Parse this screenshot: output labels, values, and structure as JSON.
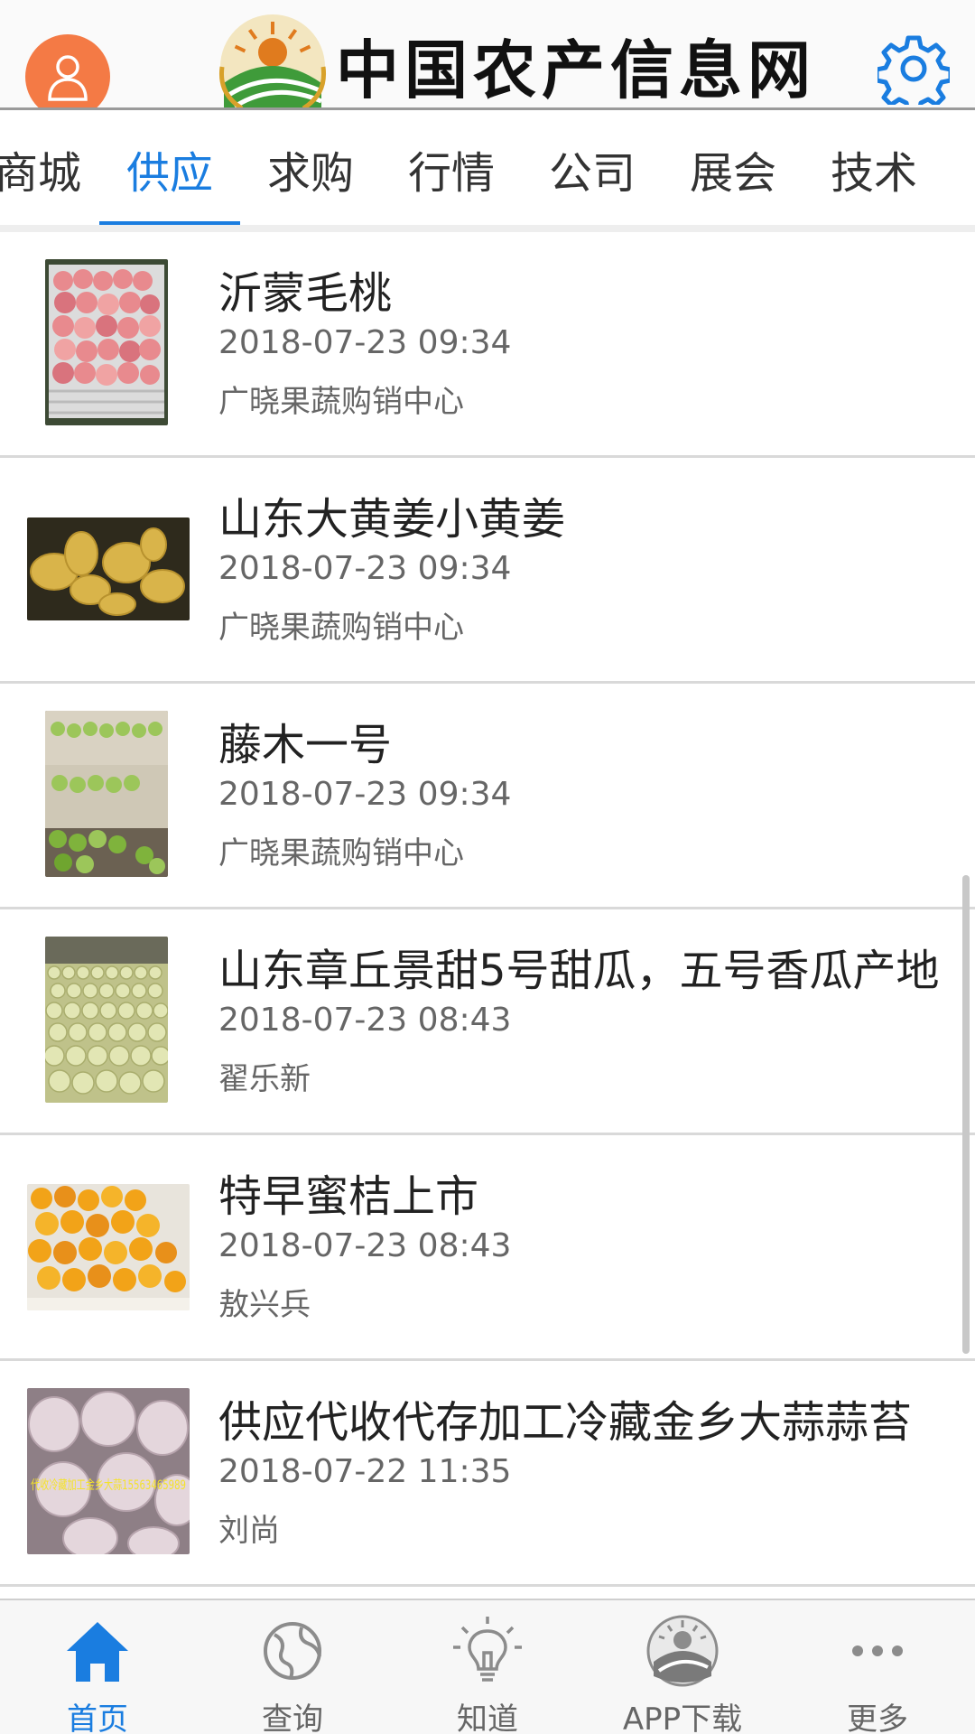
{
  "header": {
    "logo_text": "中国农产信息网",
    "avatar_icon": "user-icon",
    "settings_icon": "gear-icon",
    "accent_color": "#1a7de0",
    "avatar_color": "#f47a45"
  },
  "tabs": [
    {
      "label": "商城",
      "active": false
    },
    {
      "label": "供应",
      "active": true
    },
    {
      "label": "求购",
      "active": false
    },
    {
      "label": "行情",
      "active": false
    },
    {
      "label": "公司",
      "active": false
    },
    {
      "label": "展会",
      "active": false
    },
    {
      "label": "技术",
      "active": false
    }
  ],
  "list": {
    "items": [
      {
        "title": "沂蒙毛桃",
        "date": "2018-07-23 09:34",
        "source": "广晓果蔬购销中心",
        "image": "peaches-photo"
      },
      {
        "title": "山东大黄姜小黄姜",
        "date": "2018-07-23 09:34",
        "source": "广晓果蔬购销中心",
        "image": "ginger-photo"
      },
      {
        "title": "藤木一号",
        "date": "2018-07-23 09:34",
        "source": "广晓果蔬购销中心",
        "image": "green-apples-photo"
      },
      {
        "title": "山东章丘景甜5号甜瓜，五号香瓜产地",
        "date": "2018-07-23 08:43",
        "source": "翟乐新",
        "image": "melons-photo"
      },
      {
        "title": "特早蜜桔上市",
        "date": "2018-07-23 08:43",
        "source": "敖兴兵",
        "image": "tangerines-photo"
      },
      {
        "title": "供应代收代存加工冷藏金乡大蒜蒜苔",
        "date": "2018-07-22 11:35",
        "source": "刘尚",
        "image": "garlic-photo",
        "image_caption": "代收冷藏加工金乡大蒜15563465989"
      }
    ]
  },
  "bottom_nav": [
    {
      "label": "首页",
      "icon": "home-icon",
      "active": true
    },
    {
      "label": "查询",
      "icon": "globe-icon",
      "active": false
    },
    {
      "label": "知道",
      "icon": "lightbulb-icon",
      "active": false
    },
    {
      "label": "APP下载",
      "icon": "app-logo-icon",
      "active": false
    },
    {
      "label": "更多",
      "icon": "more-icon",
      "active": false
    }
  ]
}
